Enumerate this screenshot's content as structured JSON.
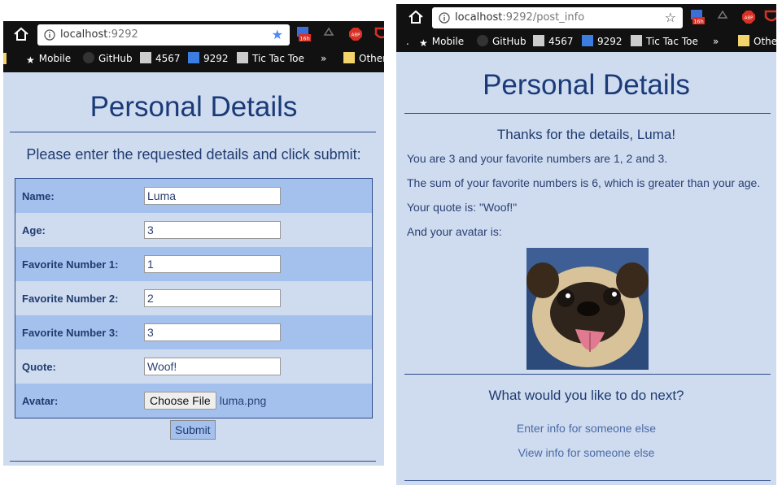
{
  "left_window": {
    "url_host": "localhost",
    "url_port": ":9292",
    "badge_time": "16h",
    "bookmarks": [
      "Mobile",
      "GitHub",
      "4567",
      "9292",
      "Tic Tac Toe",
      "»",
      "Other"
    ],
    "page_title": "Personal Details",
    "instructions": "Please enter the requested details and click submit:",
    "fields": [
      {
        "label": "Name:",
        "value": "Luma"
      },
      {
        "label": "Age:",
        "value": "3"
      },
      {
        "label": "Favorite Number 1:",
        "value": "1"
      },
      {
        "label": "Favorite Number 2:",
        "value": "2"
      },
      {
        "label": "Favorite Number 3:",
        "value": "3"
      },
      {
        "label": "Quote:",
        "value": "Woof!"
      }
    ],
    "avatar_label": "Avatar:",
    "choose_file_label": "Choose File",
    "avatar_filename": "luma.png",
    "submit_label": "Submit"
  },
  "right_window": {
    "url_host": "localhost",
    "url_path": ":9292/post_info",
    "badge_time": "16h",
    "bookmarks": [
      ".",
      "Mobile",
      "GitHub",
      "4567",
      "9292",
      "Tic Tac Toe",
      "»",
      "Othe"
    ],
    "page_title": "Personal Details",
    "thanks": "Thanks for the details, Luma!",
    "lines": [
      "You are 3 and your favorite numbers are 1, 2 and 3.",
      "The sum of your favorite numbers is 6, which is greater than your age.",
      "Your quote is: \"Woof!\"",
      "And your avatar is:"
    ],
    "next_heading": "What would you like to do next?",
    "links": [
      "Enter info for someone else",
      "View info for someone else"
    ]
  },
  "colors": {
    "page_bg": "#cfdcef",
    "row_alt": "#a4c1ee",
    "heading": "#1a3a78",
    "link": "#4a6aa8",
    "chrome": "#111111"
  }
}
